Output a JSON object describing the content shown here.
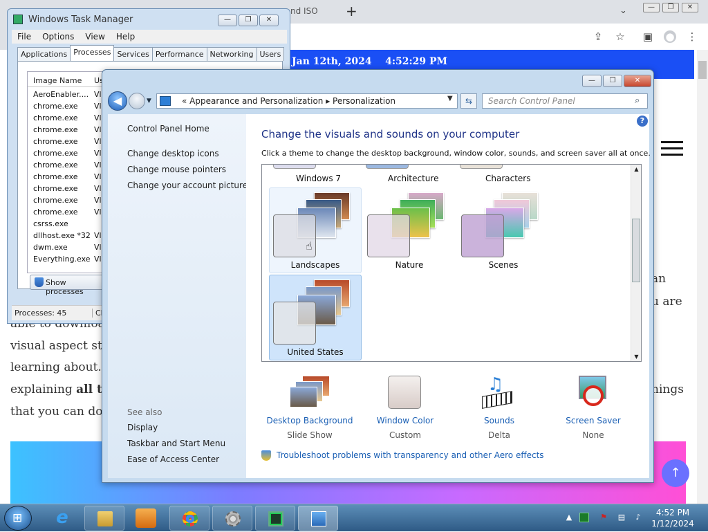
{
  "browser": {
    "tab_partial": "nd ISO",
    "new_tab": "+",
    "tab_menu": "⌄",
    "window_controls": [
      "—",
      "❐",
      "✕"
    ],
    "toolbar_icons": [
      "share-icon",
      "star-icon",
      "sidebar-icon",
      "profile-icon",
      "menu-icon"
    ],
    "date_time": "Jan 12th, 2024    4:52:29 PM",
    "article_lines": [
      {
        "text": "an"
      },
      {
        "text": "u are"
      },
      {
        "text": "able to downloa"
      },
      {
        "text": "visual aspect sta"
      },
      {
        "text": "learning about. W"
      },
      {
        "text": "explaining ",
        "bold": "all th"
      },
      {
        "text": "hings"
      },
      {
        "text": "that you can do w"
      }
    ],
    "scroll_top_icon": "↑"
  },
  "task_manager": {
    "title": "Windows Task Manager",
    "controls": [
      "—",
      "❐",
      "✕"
    ],
    "menu": [
      "File",
      "Options",
      "View",
      "Help"
    ],
    "tabs": [
      "Applications",
      "Processes",
      "Services",
      "Performance",
      "Networking",
      "Users"
    ],
    "active_tab": "Processes",
    "column_header": "Image Name",
    "column_header2": "Us",
    "processes": [
      "AeroEnabler....",
      "chrome.exe",
      "chrome.exe",
      "chrome.exe",
      "chrome.exe",
      "chrome.exe",
      "chrome.exe",
      "chrome.exe",
      "chrome.exe",
      "chrome.exe",
      "chrome.exe",
      "csrss.exe",
      "dllhost.exe *32",
      "dwm.exe",
      "Everything.exe"
    ],
    "user_col": [
      "Vl",
      "Vl",
      "Vl",
      "Vl",
      "Vl",
      "Vl",
      "Vl",
      "Vl",
      "Vl",
      "Vl",
      "Vl",
      "",
      "Vl",
      "Vl",
      "Vl"
    ],
    "show_processes_button": "Show processes",
    "status_processes": "Processes: 45",
    "status_cpu": "CPU"
  },
  "control_panel": {
    "controls": [
      "—",
      "❐",
      "✕"
    ],
    "breadcrumb": "«  Appearance and Personalization  ▸  Personalization",
    "search_placeholder": "Search Control Panel",
    "left_links": [
      "Control Panel Home",
      "Change desktop icons",
      "Change mouse pointers",
      "Change your account picture"
    ],
    "see_also": "See also",
    "see_also_links": [
      "Display",
      "Taskbar and Start Menu",
      "Ease of Access Center"
    ],
    "heading": "Change the visuals and sounds on your computer",
    "subheading": "Click a theme to change the desktop background, window color, sounds, and screen saver all at once.",
    "top_row_themes": [
      "Windows 7",
      "Architecture",
      "Characters"
    ],
    "themes": [
      "Landscapes",
      "Nature",
      "Scenes",
      "United States"
    ],
    "selected_theme": "United States",
    "options": [
      {
        "label": "Desktop Background",
        "value": "Slide Show",
        "icon": "desktop-background-icon"
      },
      {
        "label": "Window Color",
        "value": "Custom",
        "icon": "window-color-icon"
      },
      {
        "label": "Sounds",
        "value": "Delta",
        "icon": "sounds-icon"
      },
      {
        "label": "Screen Saver",
        "value": "None",
        "icon": "screen-saver-icon"
      }
    ],
    "troubleshoot_link": "Troubleshoot problems with transparency and other Aero effects",
    "help": "?"
  },
  "taskbar": {
    "pinned": [
      "ie-icon",
      "explorer-icon",
      "media-player-icon",
      "chrome-icon",
      "settings-icon",
      "task-manager-icon",
      "control-panel-icon"
    ],
    "clock_time": "4:52 PM",
    "clock_date": "1/12/2024"
  }
}
